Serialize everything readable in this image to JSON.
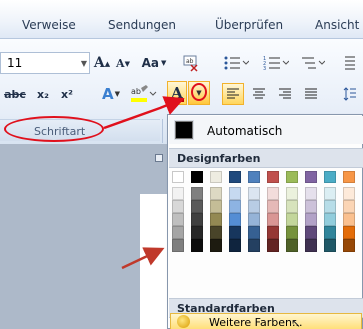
{
  "ribbon": {
    "tabs": [
      {
        "label": "Verweise"
      },
      {
        "label": "Sendungen"
      },
      {
        "label": "Überprüfen"
      },
      {
        "label": "Ansicht"
      }
    ],
    "font_size_value": "11",
    "case_label": "Aa",
    "strike_label": "abc",
    "sub_label": "x₂",
    "sup_label": "x²",
    "font_color_label": "A",
    "group_label": "Schriftart"
  },
  "dropdown": {
    "automatic_label": "Automatisch",
    "theme_colors_label": "Designfarben",
    "standard_colors_label": "Standardfarben",
    "more_colors_label": "Weitere Farben...",
    "theme_top_row": [
      "#ffffff",
      "#000000",
      "#eeece1",
      "#1f497d",
      "#4f81bd",
      "#c0504d",
      "#9bbb59",
      "#8064a2",
      "#4bacc6",
      "#f79646"
    ],
    "theme_shades": [
      [
        "#f2f2f2",
        "#7f7f7f",
        "#ddd9c3",
        "#c6d9f0",
        "#dbe5f1",
        "#f2dcdb",
        "#ebf1dd",
        "#e5e0ec",
        "#dbeef3",
        "#fdeada"
      ],
      [
        "#d8d8d8",
        "#595959",
        "#c4bd97",
        "#8db3e2",
        "#b8cce4",
        "#e5b9b7",
        "#d7e3bc",
        "#ccc1d9",
        "#b7dde8",
        "#fbd5b5"
      ],
      [
        "#bfbfbf",
        "#3f3f3f",
        "#938953",
        "#548dd4",
        "#95b3d7",
        "#d99694",
        "#c3d69b",
        "#b2a2c7",
        "#92cddc",
        "#fac08f"
      ],
      [
        "#a5a5a5",
        "#262626",
        "#494429",
        "#17365d",
        "#366092",
        "#953734",
        "#76923c",
        "#5f497a",
        "#31859b",
        "#e36c09"
      ],
      [
        "#7f7f7f",
        "#0c0c0c",
        "#1d1b10",
        "#0f243e",
        "#244061",
        "#632423",
        "#4f6128",
        "#3f3151",
        "#205867",
        "#974806"
      ]
    ],
    "standard_colors": [
      "#c00000",
      "#ff0000",
      "#ffc000",
      "#ffff00",
      "#92d050",
      "#00b050",
      "#00b0f0",
      "#0070c0",
      "#002060",
      "#7030a0"
    ]
  }
}
